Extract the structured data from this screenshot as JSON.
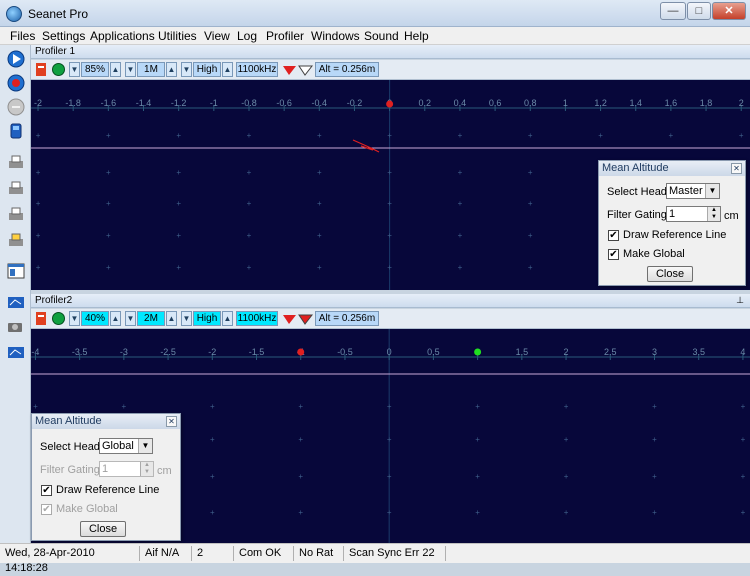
{
  "window": {
    "title": "Seanet Pro",
    "min": "—",
    "max": "□",
    "close": "✕"
  },
  "menu": [
    "Files",
    "Settings",
    "Applications",
    "Utilities",
    "View",
    "Log",
    "Profiler",
    "Windows",
    "Sound",
    "Help"
  ],
  "profiler1": {
    "title": "Profiler 1",
    "gain": "85%",
    "range": "1M",
    "freq_mode": "High",
    "freq": "1100kHz",
    "alt": "Alt = 0.256m",
    "x_labels": [
      "-2",
      "-1.8",
      "-1.6",
      "-1.4",
      "-1.2",
      "-1",
      "-0.8",
      "-0.6",
      "-0.4",
      "-0.2",
      "0",
      "0.2",
      "0.4",
      "0.6",
      "0.8",
      "1",
      "1.2",
      "1.4",
      "1.6",
      "1.8",
      "2"
    ],
    "x_values": [
      -2,
      -1.8,
      -1.6,
      -1.4,
      -1.2,
      -1,
      -0.8,
      -0.6,
      -0.4,
      -0.2,
      0,
      0.2,
      0.4,
      0.6,
      0.8,
      1,
      1.2,
      1.4,
      1.6,
      1.8,
      2
    ],
    "xlim": [
      -2.04,
      2.05
    ],
    "marker_x": 0,
    "grid": true,
    "reference_line_color": "#c8a8d8"
  },
  "dialog1": {
    "title": "Mean Altitude",
    "select_heads_label": "Select Heads",
    "select_heads_value": "Master",
    "filter_gating_label": "Filter Gating",
    "filter_gating_value": "1",
    "unit": "cm",
    "draw_ref_label": "Draw Reference Line",
    "draw_ref_checked": "✔",
    "make_global_label": "Make Global",
    "make_global_checked": "✔",
    "close_label": "Close"
  },
  "profiler2": {
    "title": "Profiler2",
    "gain": "40%",
    "range": "2M",
    "freq_mode": "High",
    "freq": "1100kHz",
    "alt": "Alt = 0.256m",
    "x_labels": [
      "-4",
      "-3.5",
      "-3",
      "-2.5",
      "-2",
      "-1.5",
      "-1",
      "-0.5",
      "0",
      "0.5",
      "1",
      "1.5",
      "2",
      "2.5",
      "3",
      "3.5",
      "4"
    ],
    "x_values": [
      -4,
      -3.5,
      -3,
      -2.5,
      -2,
      -1.5,
      -1,
      -0.5,
      0,
      0.5,
      1,
      1.5,
      2,
      2.5,
      3,
      3.5,
      4
    ],
    "xlim": [
      -4.05,
      4.08
    ],
    "marker_red_x": -1,
    "marker_green_x": 1,
    "grid": true,
    "pin": "📌"
  },
  "dialog2": {
    "title": "Mean Altitude",
    "select_heads_label": "Select Heads",
    "select_heads_value": "Global",
    "filter_gating_label": "Filter Gating",
    "filter_gating_value": "1",
    "unit": "cm",
    "draw_ref_label": "Draw Reference Line",
    "draw_ref_checked": "✔",
    "make_global_label": "Make Global",
    "make_global_checked": "✔",
    "close_label": "Close"
  },
  "status": {
    "datetime": "Wed, 28-Apr-2010 14:18:28",
    "aif": "Aif N/A",
    "count": "2",
    "com": "Com OK",
    "rat": "No Rat",
    "scan": "Scan Sync Err 22"
  },
  "colors": {
    "plot_bg": "#07073a",
    "axis": "#2a5a7a",
    "tick_label": "#6b8aa8",
    "marker_red": "#e02020",
    "marker_green": "#20e020"
  }
}
